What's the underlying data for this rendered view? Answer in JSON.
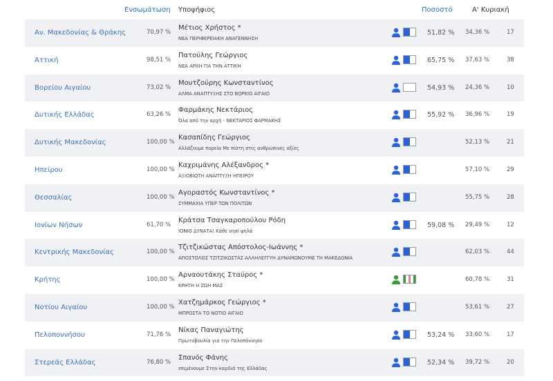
{
  "header": {
    "integration": "Ενσωμάτωση",
    "candidate": "Υποψήφιος",
    "percentage": "Ποσοστό",
    "first_sunday": "Α' Κυριακή"
  },
  "colors": {
    "accent": "#2a6ebb",
    "flag_blue": "#2b62d4",
    "crete_green": "#3a9a3a",
    "row_alt": "#f0f1f4"
  },
  "rows": [
    {
      "region": "Αν. Μακεδονίας & Θράκης",
      "integration": "70,97 %",
      "candidate": "Μέτιος Χρήστος *",
      "party": "ΝΕΑ ΠΕΡΙΦΕΡΕΙΑΚΗ ΑΝΑΓΕΝΝΗΣΗ",
      "icon": "person-icon",
      "flag_fill": 0.5,
      "percentage": "51,82 %",
      "first_sunday": "34,36 %",
      "value": "17"
    },
    {
      "region": "Αττική",
      "integration": "98,51 %",
      "candidate": "Πατούλης Γεώργιος",
      "party": "ΝΕΑ ΑΡΧΗ ΓΙΑ ΤΗΝ ΑΤΤΙΚΗ",
      "icon": "person-icon",
      "flag_fill": 0.5,
      "percentage": "65,75 %",
      "first_sunday": "37,63 %",
      "value": "38"
    },
    {
      "region": "Βορείου Αιγαίου",
      "integration": "73,02 %",
      "candidate": "Μουτζούρης Κωνσταντίνος",
      "party": "ΑΛΜΑ ΑΝΑΠΤΥΞΗΣ ΣΤΟ ΒΟΡΕΙΟ ΑΙΓΑΙΟ",
      "icon": "person-icon",
      "flag_fill": 0,
      "percentage": "54,93 %",
      "first_sunday": "24,36 %",
      "value": "10"
    },
    {
      "region": "Δυτικής Ελλάδας",
      "integration": "63,26 %",
      "candidate": "Φαρμάκης Νεκτάριος",
      "party": "Όλα από την αρχή - ΝΕΚΤΑΡΙΟΣ ΦΑΡΜΑΚΗΣ",
      "icon": "person-icon",
      "flag_fill": 0.5,
      "percentage": "55,92 %",
      "first_sunday": "36,96 %",
      "value": "19"
    },
    {
      "region": "Δυτικής Μακεδονίας",
      "integration": "100,00 %",
      "candidate": "Κασαπίδης Γεώργιος",
      "party": "Αλλάζουμε πορεία Με πίστη στις ανθρώπινες αξίες",
      "icon": "person-icon",
      "flag_fill": 0.5,
      "percentage": "",
      "first_sunday": "52,13 %",
      "value": "21"
    },
    {
      "region": "Ηπείρου",
      "integration": "100,00 %",
      "candidate": "Καχριμάνης Αλέξανδρος *",
      "party": "ΑΞΙΟΒΙΩΤΗ ΑΝΑΠΤΥΞΗ ΗΠΕΙΡΟΥ",
      "icon": "person-icon",
      "flag_fill": 0.5,
      "percentage": "",
      "first_sunday": "57,10 %",
      "value": "29"
    },
    {
      "region": "Θεσσαλίας",
      "integration": "100,00 %",
      "candidate": "Αγοραστός Κωνσταντίνος *",
      "party": "ΣΥΜΜΑΧΙΑ ΥΠΕΡ ΤΩΝ ΠΟΛΙΤΩΝ",
      "icon": "person-icon",
      "flag_fill": 0.5,
      "percentage": "",
      "first_sunday": "55,75 %",
      "value": "28"
    },
    {
      "region": "Ιονίων Νήσων",
      "integration": "61,70 %",
      "candidate": "Κράτσα Τσαγκαροπούλου Ρόδη",
      "party": "ΙΟΝΙΟ ΔΥΝΑΤΑ! Κάθε νησί ψηλά",
      "icon": "person-icon",
      "flag_fill": 0.5,
      "percentage": "59,08 %",
      "first_sunday": "29,49 %",
      "value": "12"
    },
    {
      "region": "Κεντρικής Μακεδονίας",
      "integration": "100,00 %",
      "candidate": "Τζιτζικώστας Απόστολος-Ιωάννης *",
      "party": "ΑΠΟΣΤΟΛΟΣ ΤΖΙΤΖΙΚΩΣΤΑΣ ΑΛΛΗΛΕΓΓΥΗ ΔΥΝΑΜΩΝΟΥΜΕ ΤΗ ΜΑΚΕΔΟΝΙΑ",
      "icon": "person-icon",
      "flag_fill": 0.5,
      "percentage": "",
      "first_sunday": "62,03 %",
      "value": "44"
    },
    {
      "region": "Κρήτης",
      "integration": "100,00 %",
      "candidate": "Αρναουτάκης Σταύρος *",
      "party": "ΚΡΗΤΗ Η ΖΩΗ ΜΑΣ",
      "icon": "person-green-icon",
      "flag_fill": 0,
      "flag_stripes": true,
      "percentage": "",
      "first_sunday": "60,78 %",
      "value": "31"
    },
    {
      "region": "Νοτίου Αιγαίου",
      "integration": "100,00 %",
      "candidate": "Χατζημάρκος Γεώργιος *",
      "party": "ΜΠΡΟΣΤΑ ΤΟ ΝΟΤΙΟ ΑΙΓΑΙΟ",
      "icon": "person-icon",
      "flag_fill": 0.5,
      "percentage": "",
      "first_sunday": "53,61 %",
      "value": "27"
    },
    {
      "region": "Πελοποννήσου",
      "integration": "71,76 %",
      "candidate": "Νίκας Παναγιώτης",
      "party": "Πρωτοβουλία για την Πελοπόννησο",
      "icon": "person-icon",
      "flag_fill": 0.5,
      "percentage": "53,24 %",
      "first_sunday": "33,60 %",
      "value": "17"
    },
    {
      "region": "Στερεάς Ελλάδας",
      "integration": "76,80 %",
      "candidate": "Σπανός Φάνης",
      "party": "επιμένουμε Στην καρδιά της Ελλάδας",
      "icon": "person-icon",
      "flag_fill": 0.5,
      "percentage": "52,34 %",
      "first_sunday": "39,72 %",
      "value": "20"
    }
  ]
}
